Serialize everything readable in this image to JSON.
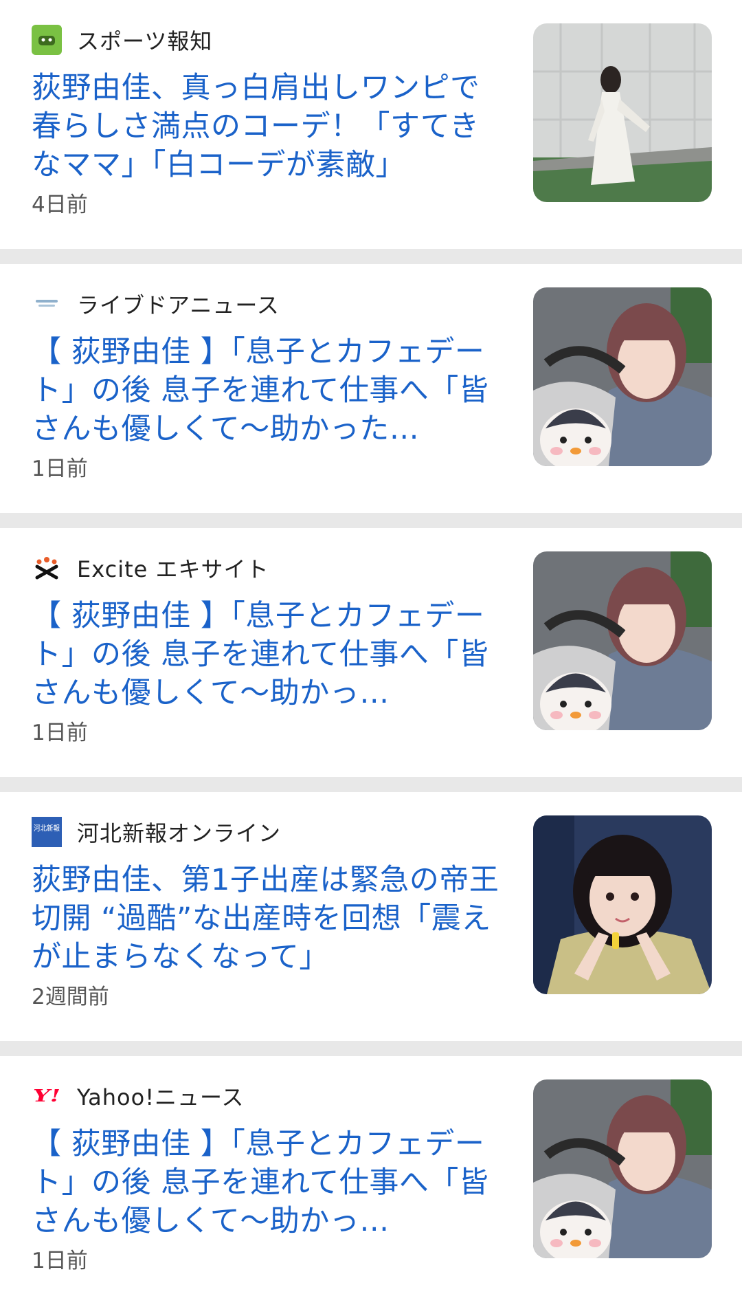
{
  "articles": [
    {
      "source": "スポーツ報知",
      "source_icon": "hochi-logo-icon",
      "headline": "荻野由佳、真っ白肩出しワンピで春らしさ満点のコーデ！「すてきなママ」「白コーデが素敵」",
      "age": "4日前",
      "thumbnail": "woman-white-dress-photo"
    },
    {
      "source": "ライブドアニュース",
      "source_icon": "livedoor-logo-icon",
      "headline": "【 荻野由佳 】「息子とカフェデート」の後 息子を連れて仕事へ「皆さんも優しくて〜助かった…",
      "age": "1日前",
      "thumbnail": "selfie-with-stroller-photo"
    },
    {
      "source": "Excite エキサイト",
      "source_icon": "excite-logo-icon",
      "headline": "【 荻野由佳 】「息子とカフェデート」の後 息子を連れて仕事へ「皆さんも優しくて〜助かっ…",
      "age": "1日前",
      "thumbnail": "selfie-with-stroller-photo"
    },
    {
      "source": "河北新報オンライン",
      "source_icon": "kahoku-logo-icon",
      "headline": "荻野由佳、第1子出産は緊急の帝王切開 “過酷”な出産時を回想「震えが止まらなくなって」",
      "age": "2週間前",
      "thumbnail": "idol-portrait-photo"
    },
    {
      "source": "Yahoo!ニュース",
      "source_icon": "yahoo-logo-icon",
      "headline": "【 荻野由佳 】「息子とカフェデート」の後 息子を連れて仕事へ「皆さんも優しくて〜助かっ…",
      "age": "1日前",
      "thumbnail": "selfie-with-stroller-photo"
    }
  ],
  "logo_text": {
    "kahoku": "河北新報",
    "yahoo": "Y!"
  },
  "colors": {
    "headline": "#1a62c9",
    "divider": "#e8e8e8",
    "hochi_green": "#7ac143",
    "yahoo_red": "#ff0033"
  }
}
